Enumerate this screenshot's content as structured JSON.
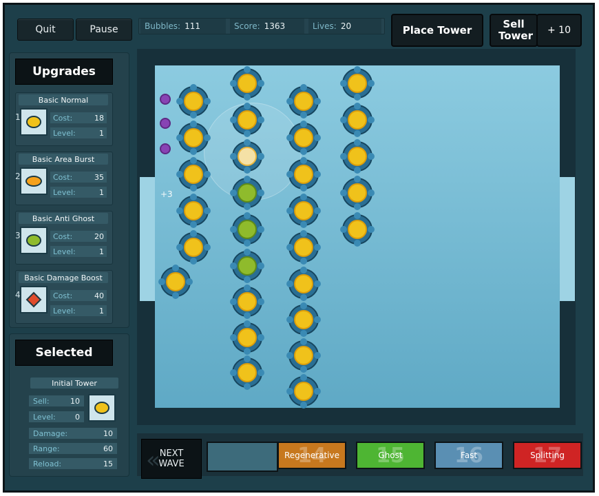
{
  "controls": {
    "quit": "Quit",
    "pause": "Pause",
    "place_tower": "Place Tower",
    "sell_tower": "Sell Tower",
    "plus_ten": "+ 10"
  },
  "stats": [
    {
      "key": "Bubbles:",
      "value": "111"
    },
    {
      "key": "Score:",
      "value": "1363"
    },
    {
      "key": "Lives:",
      "value": "20"
    }
  ],
  "upgrades": {
    "title": "Upgrades",
    "items": [
      {
        "num": "1",
        "name": "Basic Normal",
        "cost_label": "Cost:",
        "cost": "18",
        "level_label": "Level:",
        "level": "1",
        "icon": "normal-tower-icon",
        "color": "#f0c21b"
      },
      {
        "num": "2",
        "name": "Basic Area Burst",
        "cost_label": "Cost:",
        "cost": "35",
        "level_label": "Level:",
        "level": "1",
        "icon": "area-burst-tower-icon",
        "color": "#f5a11b"
      },
      {
        "num": "3",
        "name": "Basic Anti Ghost",
        "cost_label": "Cost:",
        "cost": "20",
        "level_label": "Level:",
        "level": "1",
        "icon": "anti-ghost-tower-icon",
        "color": "#8fbb2c"
      },
      {
        "num": "4",
        "name": "Basic Damage Boost",
        "cost_label": "Cost:",
        "cost": "40",
        "level_label": "Level:",
        "level": "1",
        "icon": "damage-boost-tower-icon",
        "color": "#e04b2b"
      }
    ]
  },
  "selected": {
    "title": "Selected",
    "name": "Initial Tower",
    "sell_label": "Sell:",
    "sell": "10",
    "level_label": "Level:",
    "level": "0",
    "damage_label": "Damage:",
    "damage": "10",
    "range_label": "Range:",
    "range": "60",
    "reload_label": "Reload:",
    "reload": "15"
  },
  "board": {
    "bonus_text": "+3"
  },
  "next_wave": {
    "label": "NEXT WAVE"
  },
  "waves": [
    {
      "num": "14",
      "label": "Regenerative",
      "color": "#c7781e"
    },
    {
      "num": "15",
      "label": "Ghost",
      "color": "#4eb533"
    },
    {
      "num": "16",
      "label": "Fast",
      "color": "#5a8fb3"
    },
    {
      "num": "17",
      "label": "Splitting",
      "color": "#cf2424"
    }
  ]
}
